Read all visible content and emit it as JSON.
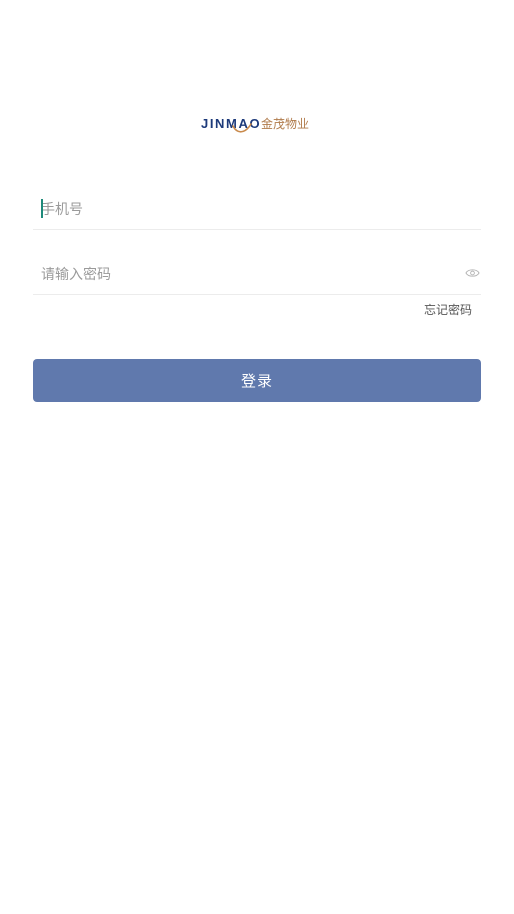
{
  "logo": {
    "wordmark": "JINMAO",
    "chinese": "金茂物业",
    "brand_color": "#1d3a7a",
    "accent_color": "#b07a4a"
  },
  "phone_field": {
    "placeholder": "手机号",
    "value": ""
  },
  "password_field": {
    "placeholder": "请输入密码",
    "value": "",
    "icon": "eye-icon"
  },
  "forgot_password": {
    "label": "忘记密码"
  },
  "login_button": {
    "label": "登录",
    "color": "#6079ad"
  },
  "colors": {
    "caret": "#1e8a7a",
    "divider": "#ececec"
  }
}
